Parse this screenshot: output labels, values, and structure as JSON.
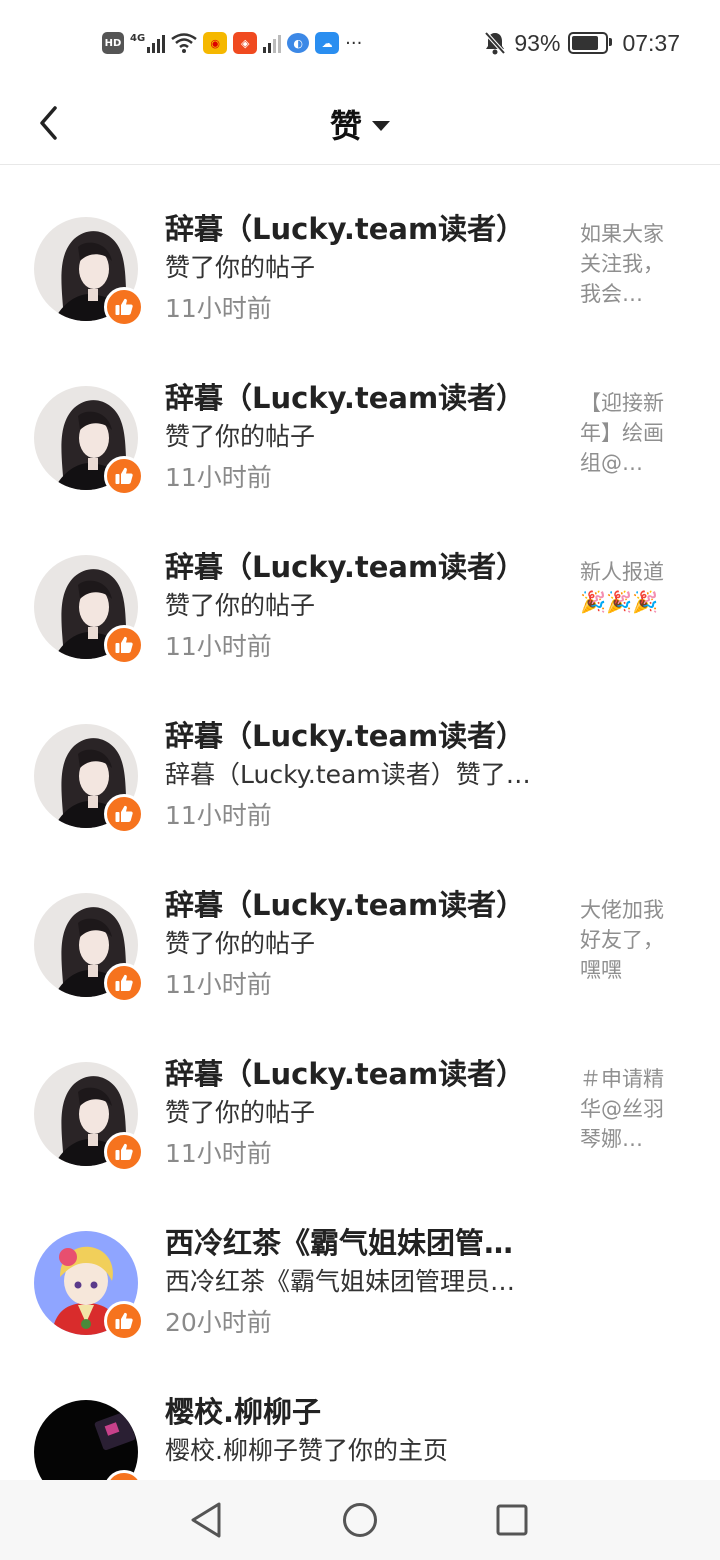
{
  "status_bar": {
    "left_icons": [
      "hd-icon",
      "signal-4g-icon",
      "wifi-icon",
      "weibo-icon",
      "app-icon",
      "signal-2-icon",
      "browser-icon",
      "weather-icon",
      "more-dots"
    ],
    "hd_label": "HD",
    "net_label": "4G",
    "more_label": "···",
    "battery_percent": "93%",
    "battery_level": 0.93,
    "time": "07:37"
  },
  "header": {
    "title": "赞"
  },
  "items": [
    {
      "name": "辞暮（Lucky.team读者）",
      "action": "赞了你的帖子",
      "time": "11小时前",
      "snippet": "如果大家关注我，我会…",
      "avatar": "dark-hair"
    },
    {
      "name": "辞暮（Lucky.team读者）",
      "action": "赞了你的帖子",
      "time": "11小时前",
      "snippet": "【迎接新年】绘画组@…",
      "avatar": "dark-hair"
    },
    {
      "name": "辞暮（Lucky.team读者）",
      "action": "赞了你的帖子",
      "time": "11小时前",
      "snippet": "新人报道🎉🎉🎉",
      "avatar": "dark-hair"
    },
    {
      "name": "辞暮（Lucky.team读者）",
      "action": "辞暮（Lucky.team读者）赞了…",
      "time": "11小时前",
      "snippet": "",
      "avatar": "dark-hair"
    },
    {
      "name": "辞暮（Lucky.team读者）",
      "action": "赞了你的帖子",
      "time": "11小时前",
      "snippet": "大佬加我好友了，嘿嘿",
      "avatar": "dark-hair"
    },
    {
      "name": "辞暮（Lucky.team读者）",
      "action": "赞了你的帖子",
      "time": "11小时前",
      "snippet": "＃申请精华@丝羽琴娜…",
      "avatar": "dark-hair"
    },
    {
      "name": "西冷红茶《霸气姐妹团管…",
      "action": "西冷红茶《霸气姐妹团管理员…",
      "time": "20小时前",
      "snippet": "",
      "avatar": "anime-blonde"
    },
    {
      "name": "樱校.柳柳子",
      "action": "樱校.柳柳子赞了你的主页",
      "time": "",
      "snippet": "",
      "avatar": "black"
    }
  ],
  "colors": {
    "accent_orange": "#f6731e",
    "name_text": "#222222",
    "time_text": "#8a8a8a",
    "snippet_text": "#8f8f8f"
  }
}
